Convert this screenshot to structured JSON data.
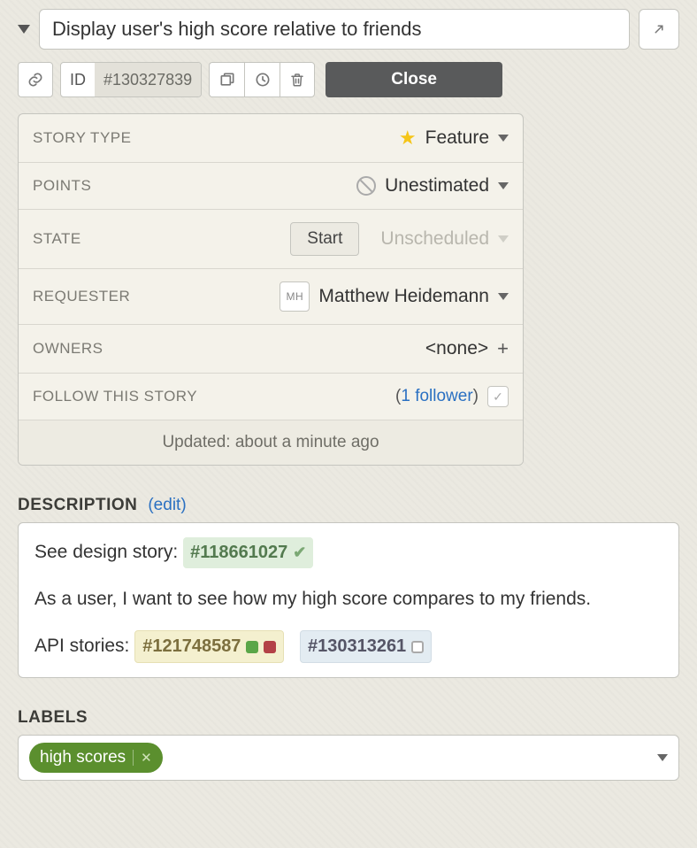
{
  "title": "Display user's high score relative to friends",
  "toolbar": {
    "id_label": "ID",
    "id_value": "#130327839",
    "close_label": "Close"
  },
  "properties": {
    "story_type": {
      "label": "STORY TYPE",
      "value": "Feature"
    },
    "points": {
      "label": "POINTS",
      "value": "Unestimated"
    },
    "state": {
      "label": "STATE",
      "value": "Unscheduled",
      "action": "Start"
    },
    "requester": {
      "label": "REQUESTER",
      "initials": "MH",
      "name": "Matthew Heidemann"
    },
    "owners": {
      "label": "OWNERS",
      "value": "<none>"
    },
    "follow": {
      "label": "FOLLOW THIS STORY",
      "followers_text": "1 follower"
    },
    "updated": "Updated: about a minute ago"
  },
  "description": {
    "heading": "DESCRIPTION",
    "edit_label": "(edit)",
    "line1_prefix": "See design story: ",
    "design_story": "#118661027",
    "body": "As a user, I want to see how my high score compares to my friends.",
    "line3_prefix": "API stories: ",
    "api_story_1": "#121748587",
    "api_story_2": "#130313261"
  },
  "labels": {
    "heading": "LABELS",
    "items": [
      "high scores"
    ]
  }
}
